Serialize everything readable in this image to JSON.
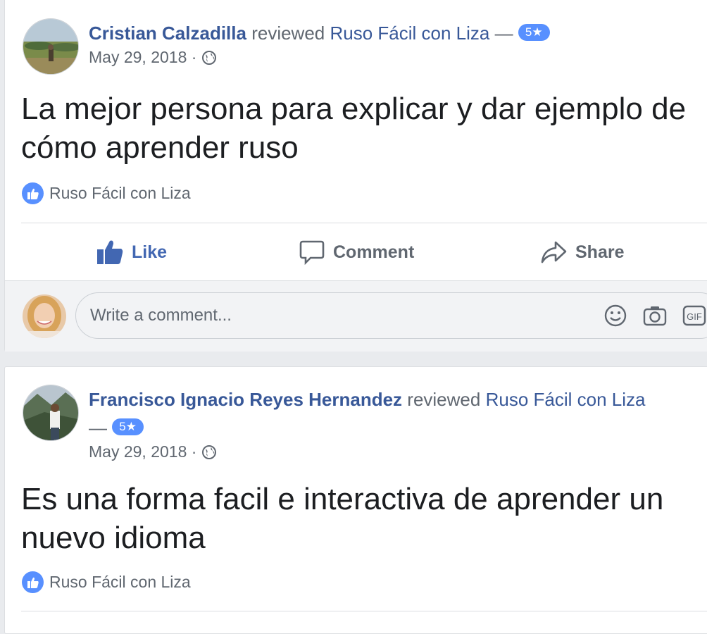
{
  "posts": [
    {
      "author": "Cristian Calzadilla",
      "verb": "reviewed",
      "page": "Ruso Fácil con Liza",
      "dash": "—",
      "rating": "5★",
      "date": "May 29, 2018",
      "separator": "·",
      "text": "La mejor persona para explicar y dar ejemplo de cómo aprender ruso",
      "liked_by": "Ruso Fácil con Liza"
    },
    {
      "author": "Francisco Ignacio Reyes Hernandez",
      "verb": "reviewed",
      "page": "Ruso Fácil con Liza",
      "dash": "—",
      "rating": "5★",
      "date": "May 29, 2018",
      "separator": "·",
      "text": "Es una forma facil e interactiva de aprender un nuevo idioma",
      "liked_by": "Ruso Fácil con Liza"
    }
  ],
  "actions": {
    "like": "Like",
    "comment": "Comment",
    "share": "Share"
  },
  "comment_box": {
    "placeholder": "Write a comment..."
  },
  "icons": [
    "globe-icon",
    "thumbs-up-icon",
    "comment-icon",
    "share-icon",
    "emoji-icon",
    "camera-icon",
    "gif-icon"
  ],
  "colors": {
    "link": "#385898",
    "accent": "#4267b2",
    "star_badge": "#5890ff",
    "muted": "#606770"
  }
}
